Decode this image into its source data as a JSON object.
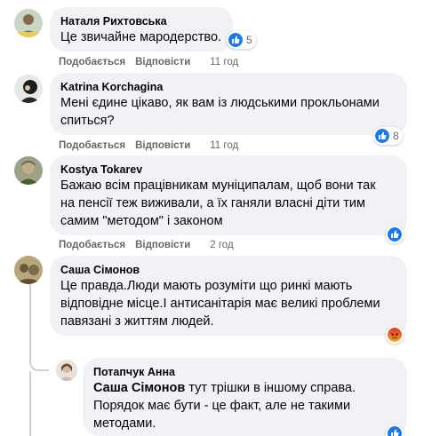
{
  "comments": [
    {
      "author": "Наталя Рихтовська",
      "text": "Це звичайне мародерство.",
      "like_label": "Подобається",
      "reply_label": "Відповісти",
      "time": "11 год",
      "reaction_count": "5",
      "reaction_icon": "like-icon"
    },
    {
      "author": "Katrina Korchagina",
      "text_line1": "Мені єдине цікаво, як вам із людськими прокльонами",
      "text_line2": "спиться?",
      "like_label": "Подобається",
      "reply_label": "Відповісти",
      "time": "11 год",
      "reaction_count": "8",
      "reaction_icon": "like-icon"
    },
    {
      "author": "Kostya Tokarev",
      "text_line1": "Бажаю всім працівникам муніципалам, щоб вони так",
      "text_line2": "на пенсії теж виживали, а їх ганяли власні діти тим",
      "text_line3": "самим \"методом\" і законом",
      "like_label": "Подобається",
      "reply_label": "Відповісти",
      "time": "2 год",
      "reaction_icon": "like-icon"
    },
    {
      "author": "Саша Сімонов",
      "text_line1": "Це правда.Люди мають розуміти що ринкі мають",
      "text_line2": "відповідне місце.І антисанітарія має великі проблеми",
      "text_line3": "павязані з життям людей.",
      "reaction_icon": "angry-icon"
    },
    {
      "author": "Потапчук Анна",
      "mention": "Саша Сімонов",
      "text_line1_rest": " тут трішки в іншому справа.",
      "text_line2": "Порядок має бути - це факт, але не такими",
      "text_line3": "методами.",
      "reaction_icon": "like-icon"
    }
  ],
  "colors": {
    "bubble": "#f0f2f5",
    "like_blue": "#1877f2",
    "angry_orange": "#e9710f",
    "meta_gray": "#65676b",
    "thread_line": "#ced0d4"
  }
}
